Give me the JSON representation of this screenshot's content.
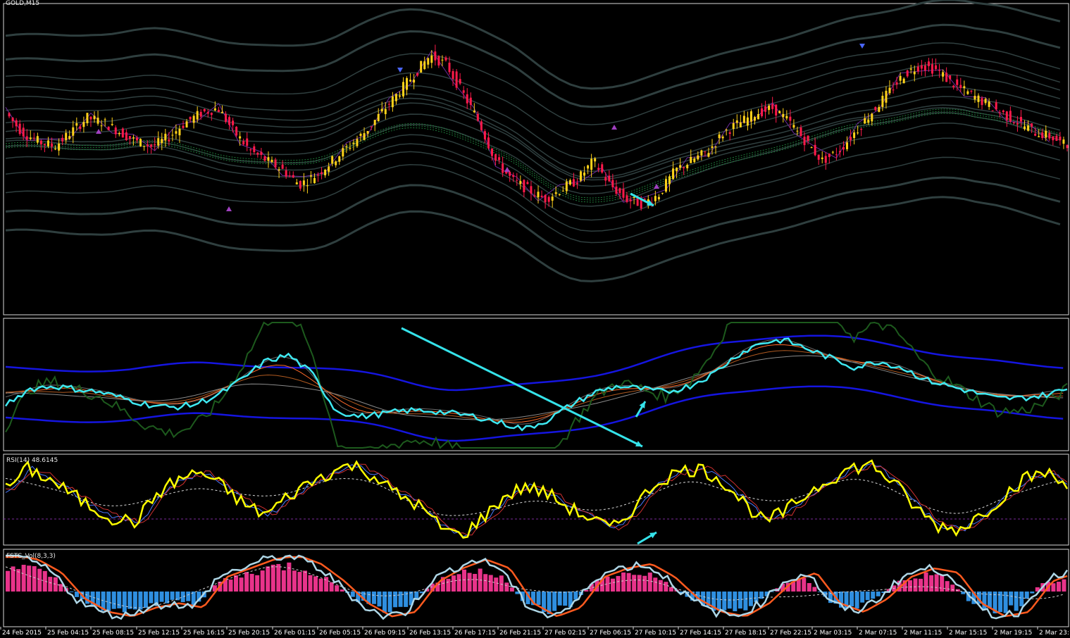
{
  "window": {
    "title": "GOLD,M15"
  },
  "panels": {
    "main": {
      "symbol_label": "GOLD,M15"
    },
    "rsi": {
      "label": "RSI(14) 48.6145"
    },
    "stoch": {
      "label": "FSTC_Vol(8,3,3)"
    }
  },
  "colors": {
    "background": "#000000",
    "border": "#d8d8d8",
    "candle_up": "#ffd21a",
    "candle_down": "#ff1a4a",
    "band_grey": "#2f3f3f",
    "band_green": "#1f7a3a",
    "annotation_arrow": "#35e3ea",
    "osc_cyan": "#3fe9f2",
    "osc_blue": "#1515e0",
    "osc_green": "#1d5a1d",
    "rsi_yellow": "#ffff00",
    "hist_pink": "#e8338a",
    "hist_blue": "#2f8fe0",
    "stoch_light": "#aed6e6",
    "stoch_orange": "#ff5a1f"
  },
  "chart_data": [
    {
      "type": "candlestick",
      "title": "GOLD,M15",
      "series": [
        {
          "name": "close (approx, relative)",
          "values": [
            62,
            58,
            56,
            55,
            58,
            61,
            60,
            58,
            56,
            55,
            57,
            60,
            62,
            63,
            58,
            54,
            52,
            50,
            47,
            49,
            52,
            55,
            58,
            62,
            66,
            70,
            74,
            72,
            66,
            60,
            52,
            48,
            46,
            44,
            46,
            48,
            52,
            47,
            44,
            43,
            45,
            50,
            52,
            54,
            58,
            60,
            62,
            63,
            60,
            56,
            52,
            54,
            58,
            62,
            66,
            70,
            72,
            71,
            68,
            66,
            64,
            62,
            60,
            58,
            57,
            55
          ]
        }
      ],
      "markers": [
        "up-arrow",
        "down-arrow"
      ]
    },
    {
      "type": "line",
      "title": "",
      "series": [
        {
          "name": "main oscillator",
          "values": [
            50,
            55,
            56,
            55,
            54,
            52,
            50,
            49,
            50,
            53,
            58,
            64,
            66,
            60,
            48,
            46,
            47,
            48,
            48,
            47,
            46,
            44,
            42,
            45,
            50,
            54,
            56,
            55,
            54,
            56,
            60,
            66,
            70,
            71,
            68,
            65,
            62,
            64,
            62,
            58,
            56,
            54,
            52,
            52,
            53,
            55
          ]
        }
      ]
    },
    {
      "type": "line",
      "title": "RSI(14) 48.6145",
      "series": [
        {
          "name": "RSI",
          "values": [
            60,
            72,
            66,
            58,
            50,
            44,
            42,
            58,
            66,
            70,
            62,
            52,
            46,
            56,
            64,
            70,
            74,
            68,
            58,
            52,
            40,
            34,
            44,
            56,
            62,
            58,
            50,
            44,
            38,
            50,
            64,
            70,
            72,
            66,
            54,
            42,
            48,
            58,
            66,
            72,
            74,
            64,
            50,
            40,
            38,
            46,
            56,
            66,
            70,
            62
          ]
        }
      ]
    },
    {
      "type": "bar",
      "title": "FSTC_Vol(8,3,3)",
      "series": [
        {
          "name": "histogram",
          "values": [
            0.8,
            0.7,
            0.4,
            -0.2,
            -0.5,
            -0.6,
            -0.4,
            -0.3,
            -0.4,
            0.3,
            0.5,
            0.7,
            0.8,
            0.6,
            0.2,
            -0.3,
            -0.6,
            -0.5,
            0.2,
            0.5,
            0.7,
            0.5,
            -0.3,
            -0.6,
            -0.4,
            0.3,
            0.5,
            0.6,
            0.3,
            -0.2,
            -0.5,
            -0.6,
            -0.3,
            0.2,
            0.4,
            -0.3,
            -0.5,
            -0.2,
            0.3,
            0.5,
            0.4,
            -0.3,
            -0.6,
            -0.5,
            0.2,
            0.4
          ]
        }
      ]
    }
  ],
  "xaxis": {
    "ticks": [
      "24 Feb 2015",
      "25 Feb 04:15",
      "25 Feb 08:15",
      "25 Feb 12:15",
      "25 Feb 16:15",
      "25 Feb 20:15",
      "26 Feb 01:15",
      "26 Feb 05:15",
      "26 Feb 09:15",
      "26 Feb 13:15",
      "26 Feb 17:15",
      "26 Feb 21:15",
      "27 Feb 02:15",
      "27 Feb 06:15",
      "27 Feb 10:15",
      "27 Feb 14:15",
      "27 Feb 18:15",
      "27 Feb 22:15",
      "2 Mar 03:15",
      "2 Mar 07:15",
      "2 Mar 11:15",
      "2 Mar 15:15",
      "2 Mar 19:15",
      "2 Mar 23:15"
    ]
  }
}
